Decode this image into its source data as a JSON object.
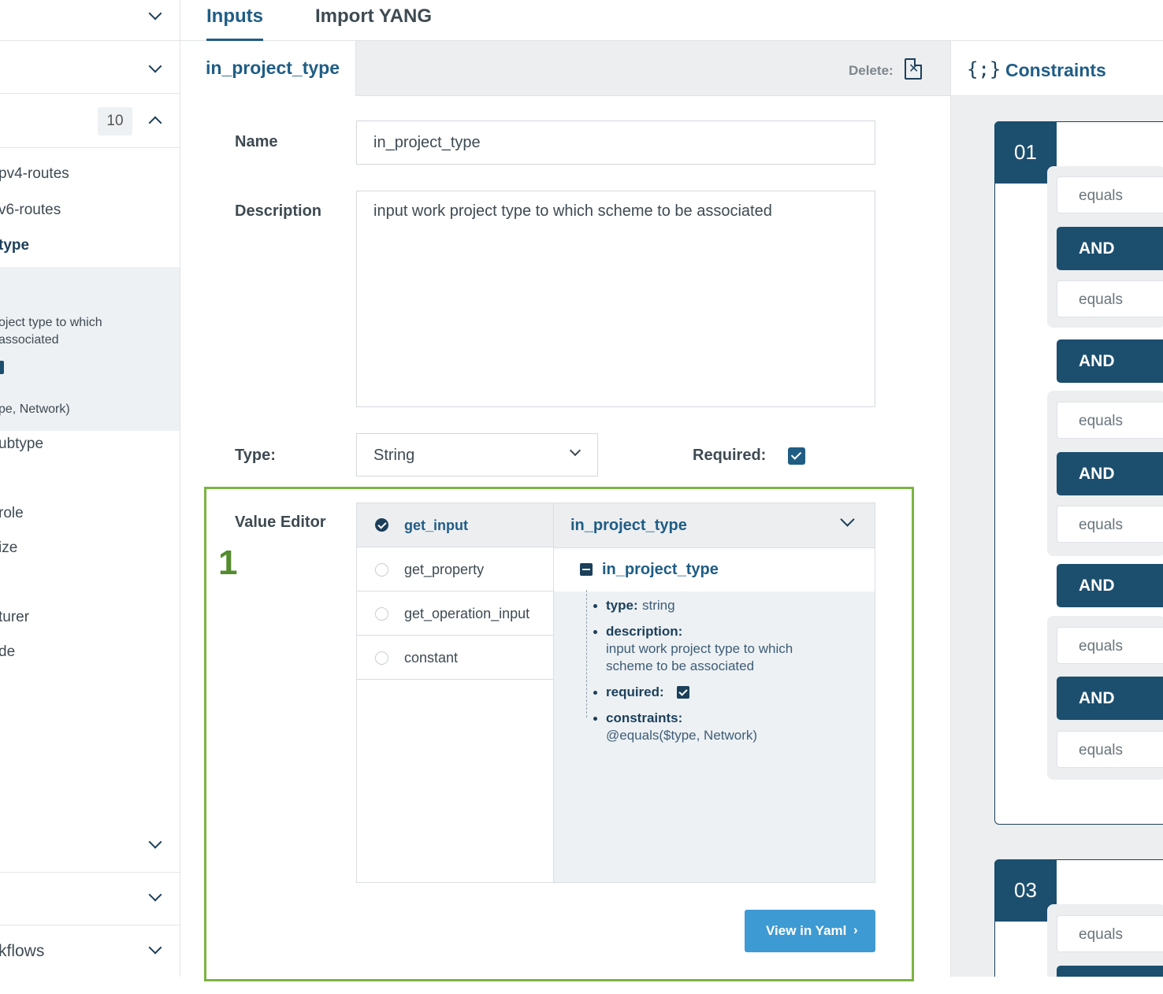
{
  "sidebar": {
    "badge_count": "10",
    "items": [
      {
        "label": "pv4-routes"
      },
      {
        "label": "v6-routes"
      },
      {
        "label": "type"
      }
    ],
    "detail": {
      "description_line1": "oject type to which",
      "description_line2": " associated",
      "constraints": "pe, Network)"
    },
    "items_after": [
      {
        "label": "ubtype"
      },
      {
        "label": "role"
      },
      {
        "label": "ize"
      },
      {
        "label": "turer"
      },
      {
        "label": "de"
      }
    ],
    "footer_label": "kflows"
  },
  "tabs": {
    "inputs": "Inputs",
    "import_yang": "Import YANG"
  },
  "input_header": {
    "title": "in_project_type",
    "delete_label": "Delete:",
    "delete_icon_glyph": "✕"
  },
  "form": {
    "name_label": "Name",
    "name_value": "in_project_type",
    "description_label": "Description",
    "description_value": "input work project type to which scheme to be associated",
    "type_label": "Type:",
    "type_value": "String",
    "required_label": "Required:",
    "required_checked": true
  },
  "value_editor": {
    "label": "Value Editor",
    "annotation": "1",
    "options": [
      {
        "label": "get_input",
        "selected": true
      },
      {
        "label": "get_property",
        "selected": false
      },
      {
        "label": "get_operation_input",
        "selected": false
      },
      {
        "label": "constant",
        "selected": false
      }
    ],
    "selected_input": "in_project_type",
    "tree": {
      "root": "in_project_type",
      "type_key": "type:",
      "type_val": "string",
      "description_key": "description:",
      "description_line1": "input work project type to which",
      "description_line2": "scheme to be associated",
      "required_key": "required:",
      "constraints_key": "constraints:",
      "constraints_val": "@equals($type, Network)"
    },
    "view_yaml": "View in Yaml",
    "view_yaml_arrow": "›"
  },
  "constraints": {
    "title": "Constraints",
    "icon_glyph": "{;}",
    "groups": [
      {
        "number": "01"
      },
      {
        "number": "03"
      }
    ],
    "condition_label": "equals",
    "and_label": "AND"
  },
  "colors": {
    "primary": "#1f5d85",
    "dark_navy": "#1c4e6e",
    "button_blue": "#3e9ad2",
    "highlight_green": "#7cb342"
  }
}
